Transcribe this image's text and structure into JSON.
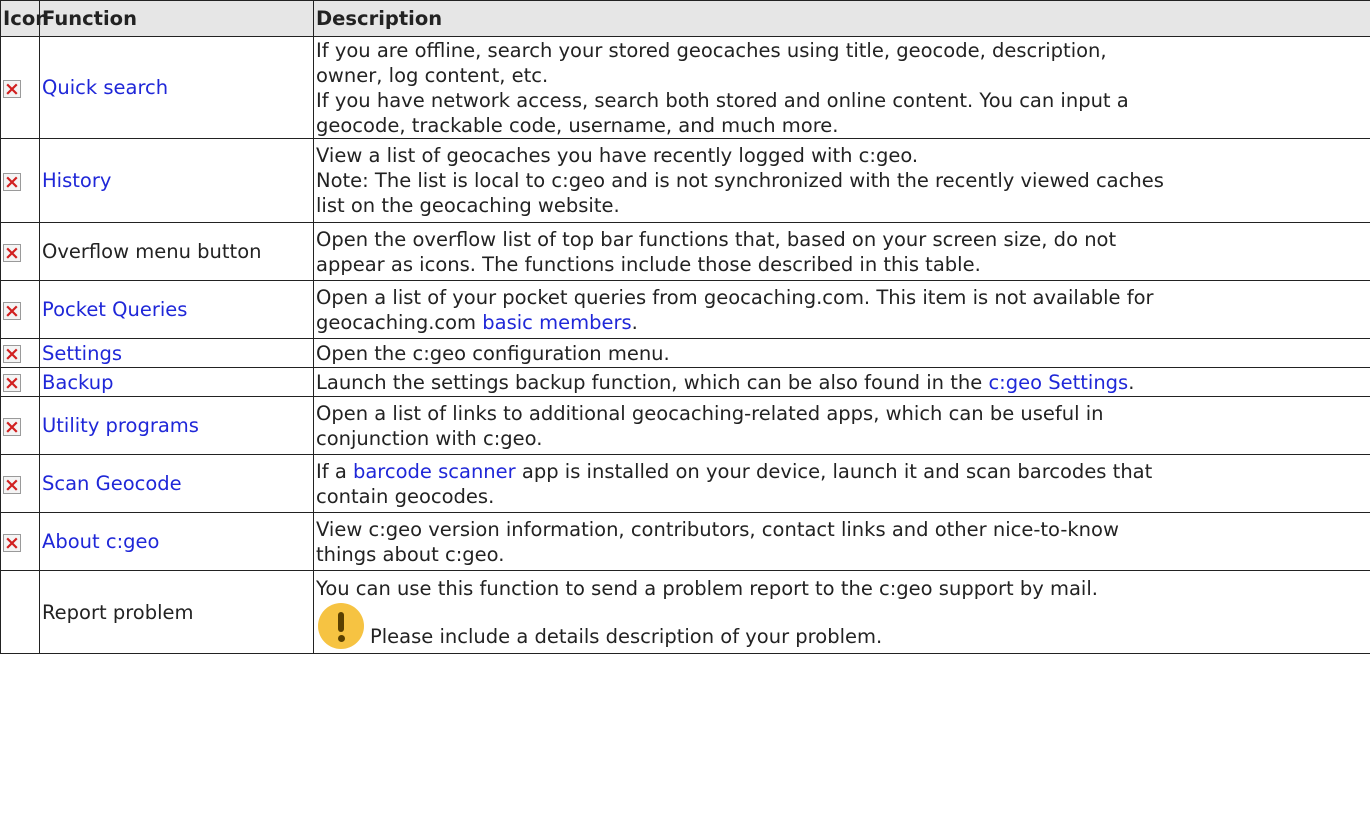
{
  "headers": {
    "icon": "Icon",
    "function": "Function",
    "description": "Description"
  },
  "rows": [
    {
      "function": "Quick search",
      "function_is_link": true,
      "icon": "broken-image-icon",
      "desc_lines": [
        "If you are offline, search your stored geocaches using title, geocode, description,",
        "owner, log content, etc.",
        "If you have network access, search both stored and online content. You can input a",
        "geocode, trackable code, username, and much more."
      ]
    },
    {
      "function": "History",
      "function_is_link": true,
      "icon": "broken-image-icon",
      "desc_lines": [
        "View a list of geocaches you have recently logged with c:geo.",
        "Note: The list is local to c:geo and is not synchronized with the recently viewed caches",
        "list on the geocaching website."
      ]
    },
    {
      "function": "Overflow menu button",
      "function_is_link": false,
      "icon": "broken-image-icon",
      "desc_lines": [
        "Open the overflow list of top bar functions that, based on your screen size, do not",
        "appear as icons. The functions include those described in this table."
      ]
    },
    {
      "function": "Pocket Queries",
      "function_is_link": true,
      "icon": "broken-image-icon",
      "desc_line1": "Open a list of your pocket queries from geocaching.com. This item is not available for",
      "desc_line2_pre": "geocaching.com ",
      "desc_line2_link": "basic members",
      "desc_line2_post": "."
    },
    {
      "function": "Settings",
      "function_is_link": true,
      "icon": "broken-image-icon",
      "desc_lines": [
        "Open the c:geo configuration menu."
      ]
    },
    {
      "function": "Backup",
      "function_is_link": true,
      "icon": "broken-image-icon",
      "desc_pre": "Launch the settings backup function, which can be also found in the ",
      "desc_link": "c:geo Settings",
      "desc_post": "."
    },
    {
      "function": "Utility programs",
      "function_is_link": true,
      "icon": "broken-image-icon",
      "desc_lines": [
        "Open a list of links to additional geocaching-related apps, which can be useful in",
        "conjunction with c:geo."
      ]
    },
    {
      "function": "Scan Geocode",
      "function_is_link": true,
      "icon": "broken-image-icon",
      "desc_pre": "If a ",
      "desc_link": "barcode scanner",
      "desc_post": " app is installed on your device, launch it and scan barcodes that",
      "desc_line2": "contain geocodes."
    },
    {
      "function": "About c:geo",
      "function_is_link": true,
      "icon": "broken-image-icon",
      "desc_lines": [
        "View c:geo version information, contributors, contact links and other nice-to-know",
        "things about c:geo."
      ]
    },
    {
      "function": "Report problem",
      "function_is_link": false,
      "icon": "",
      "desc_line1": "You can use this function to send a problem report to the c:geo support by mail.",
      "warning_icon": "exclamation-warning-icon",
      "desc_note": "Please include a details description of your problem."
    }
  ]
}
